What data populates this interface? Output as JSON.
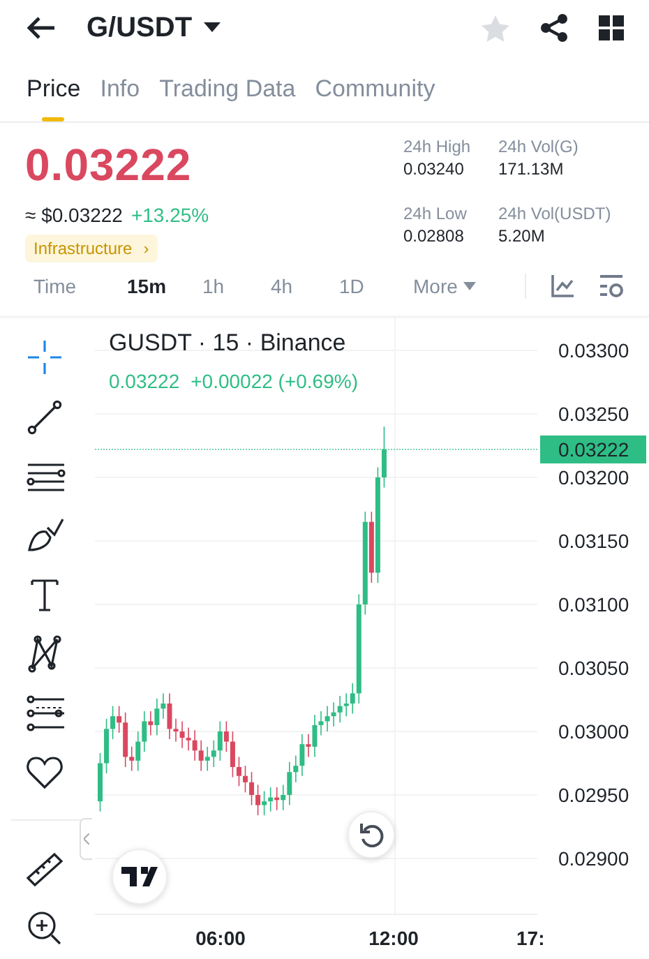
{
  "header": {
    "pair": "G/USDT",
    "favorite": false
  },
  "tabs": [
    {
      "label": "Price",
      "selected": true
    },
    {
      "label": "Info",
      "selected": false
    },
    {
      "label": "Trading Data",
      "selected": false
    },
    {
      "label": "Community",
      "selected": false
    }
  ],
  "price": {
    "last": "0.03222",
    "usd": "≈ $0.03222",
    "change": "+13.25%",
    "tag": "Infrastructure",
    "tag_arrow": "›"
  },
  "stats": [
    {
      "label": "24h High",
      "value": "0.03240"
    },
    {
      "label": "24h Vol(G)",
      "value": "171.13M"
    },
    {
      "label": "24h Low",
      "value": "0.02808"
    },
    {
      "label": "24h Vol(USDT)",
      "value": "5.20M"
    }
  ],
  "intervals": [
    {
      "label": "Time",
      "kind": "interval",
      "selected": false
    },
    {
      "label": "15m",
      "kind": "interval",
      "selected": true
    },
    {
      "label": "1h",
      "kind": "interval",
      "selected": false
    },
    {
      "label": "4h",
      "kind": "interval",
      "selected": false
    },
    {
      "label": "1D",
      "kind": "interval",
      "selected": false
    },
    {
      "label": "More",
      "kind": "dropdown",
      "selected": false
    }
  ],
  "tools": [
    {
      "kind": "crosshair",
      "selected": true
    },
    {
      "kind": "trend-line",
      "selected": false
    },
    {
      "kind": "parallel-lines",
      "selected": false
    },
    {
      "kind": "brush",
      "selected": false
    },
    {
      "kind": "text",
      "selected": false
    },
    {
      "kind": "pattern",
      "selected": false
    },
    {
      "kind": "fib",
      "selected": false
    },
    {
      "kind": "heart",
      "selected": false
    },
    {
      "kind": "ruler",
      "selected": false
    },
    {
      "kind": "zoom",
      "selected": false
    }
  ],
  "chart": {
    "title": "GUSDT · 15 · Binance",
    "last": "0.03222",
    "change": "+0.00022 (+0.69%)",
    "price_axis": [
      "0.03300",
      "0.03250",
      "0.03200",
      "0.03150",
      "0.03100",
      "0.03050",
      "0.03000",
      "0.02950",
      "0.02900"
    ],
    "current_price": "0.03222",
    "time_axis": [
      "06:00",
      "12:00",
      "17:"
    ]
  }
}
